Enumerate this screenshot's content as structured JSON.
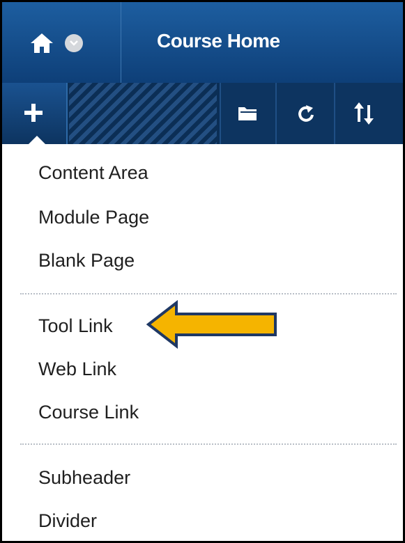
{
  "header": {
    "title": "Course Home",
    "home_icon": "home-icon",
    "menu_icon": "chevron-down-circle-icon"
  },
  "toolbar": {
    "add_icon": "plus-icon",
    "folder_icon": "folder-icon",
    "refresh_icon": "refresh-icon",
    "sort_icon": "sort-icon"
  },
  "menu": {
    "group1": [
      "Content Area",
      "Module Page",
      "Blank Page"
    ],
    "group2": [
      "Tool Link",
      "Web Link",
      "Course Link"
    ],
    "group3": [
      "Subheader",
      "Divider"
    ]
  },
  "annotation": {
    "arrow_target": "Tool Link",
    "arrow_color": "#f5b400"
  },
  "colors": {
    "header": "#1d5ea0",
    "toolbar": "#0b2e55"
  }
}
